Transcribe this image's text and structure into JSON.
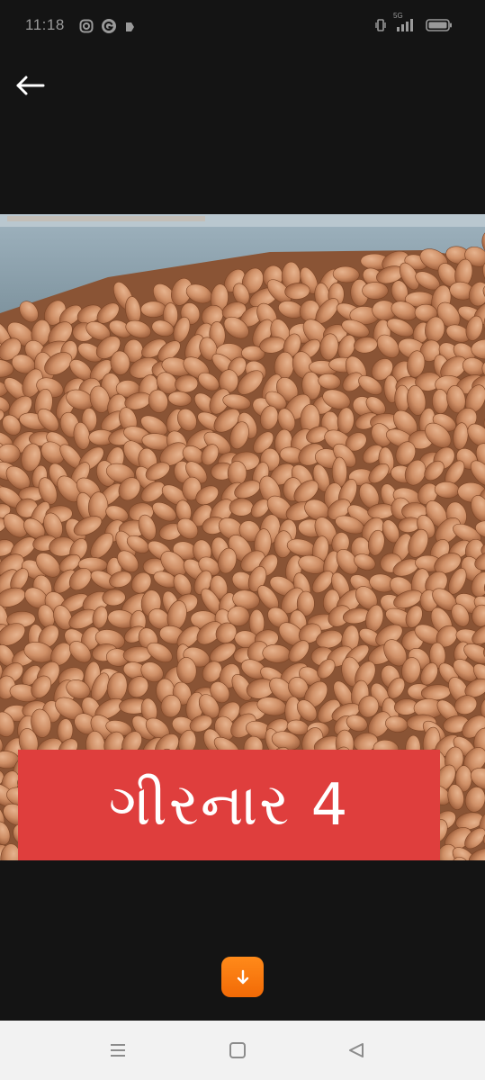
{
  "status_bar": {
    "time": "11:18",
    "left_icons": [
      "instagram-icon",
      "g-icon",
      "tag-icon"
    ],
    "right_icons": [
      "vibrate-icon",
      "signal-icon",
      "battery-icon"
    ],
    "network_label": "5G"
  },
  "header": {
    "back_icon": "arrow-left-icon"
  },
  "image": {
    "caption": "ગીરનાર 4",
    "caption_color": "#df3e3d"
  },
  "download_button": {
    "icon": "arrow-down-icon",
    "color": "#f7780f"
  },
  "nav_bar": {
    "buttons": [
      "menu-icon",
      "home-square-icon",
      "back-triangle-icon"
    ]
  }
}
